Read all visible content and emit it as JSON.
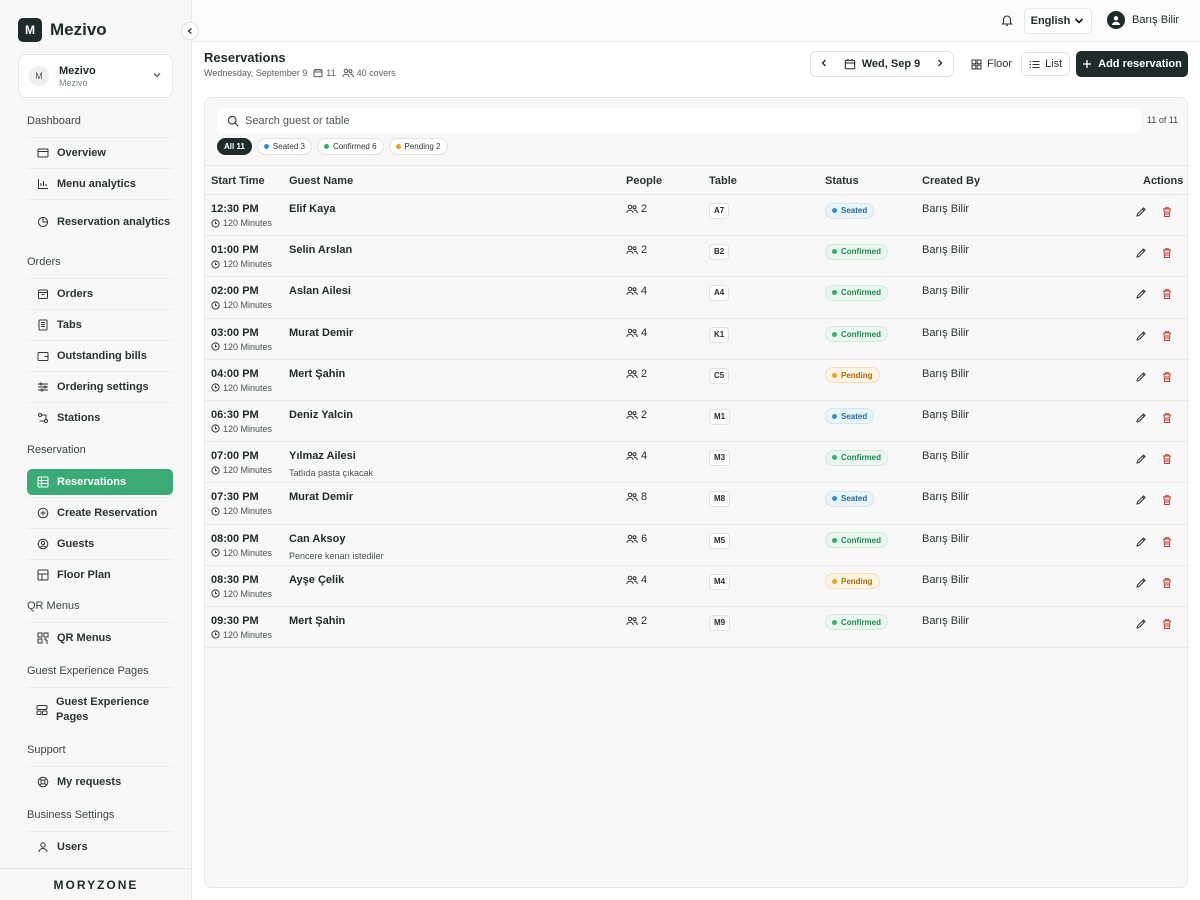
{
  "brand": {
    "logo_letter": "M",
    "name": "Mezivo"
  },
  "org": {
    "avatar": "M",
    "name": "Mezivo",
    "subtitle": "Mezivo"
  },
  "sidebar": {
    "sections": [
      {
        "title": "Dashboard",
        "items": [
          {
            "label": "Overview",
            "icon": "overview-icon"
          },
          {
            "label": "Menu analytics",
            "icon": "bar-chart-icon"
          },
          {
            "label": "Reservation analytics",
            "icon": "pie-chart-icon"
          }
        ]
      },
      {
        "title": "Orders",
        "items": [
          {
            "label": "Orders",
            "icon": "box-icon"
          },
          {
            "label": "Tabs",
            "icon": "receipt-icon"
          },
          {
            "label": "Outstanding bills",
            "icon": "wallet-icon"
          },
          {
            "label": "Ordering settings",
            "icon": "sliders-icon"
          },
          {
            "label": "Stations",
            "icon": "stations-icon"
          }
        ]
      },
      {
        "title": "Reservation",
        "items": [
          {
            "label": "Reservations",
            "icon": "grid-icon",
            "active": true
          },
          {
            "label": "Create Reservation",
            "icon": "plus-circle-icon"
          },
          {
            "label": "Guests",
            "icon": "user-circle-icon"
          },
          {
            "label": "Floor Plan",
            "icon": "floor-plan-icon"
          }
        ]
      },
      {
        "title": "QR Menus",
        "items": [
          {
            "label": "QR Menus",
            "icon": "qr-icon"
          }
        ]
      },
      {
        "title": "Guest Experience Pages",
        "items": [
          {
            "label": "Guest Experience Pages",
            "icon": "layout-icon"
          }
        ]
      },
      {
        "title": "Support",
        "items": [
          {
            "label": "My requests",
            "icon": "lifebuoy-icon"
          }
        ]
      },
      {
        "title": "Business Settings",
        "items": [
          {
            "label": "Users",
            "icon": "users-icon"
          }
        ]
      }
    ],
    "footer_logo": "MORYZONE"
  },
  "topbar": {
    "language": "English",
    "user_name": "Barış Bilir"
  },
  "header": {
    "title": "Reservations",
    "date_long": "Wednesday, September 9",
    "reservations_count": "11",
    "covers": "40 covers",
    "date_short": "Wed, Sep 9",
    "view_floor": "Floor",
    "view_list": "List",
    "add_label": "Add reservation"
  },
  "search": {
    "placeholder": "Search guest or table",
    "count": "11 of 11"
  },
  "filters": [
    {
      "label": "All 11",
      "active": true,
      "color": ""
    },
    {
      "label": "Seated 3",
      "active": false,
      "color": "#2b8fd6"
    },
    {
      "label": "Confirmed 6",
      "active": false,
      "color": "#2fb36a"
    },
    {
      "label": "Pending 2",
      "active": false,
      "color": "#f0a020"
    }
  ],
  "table": {
    "columns": [
      "Start Time",
      "Guest Name",
      "People",
      "Table",
      "Status",
      "Created By",
      "Actions"
    ],
    "rows": [
      {
        "time": "12:30 PM",
        "duration": "120 Minutes",
        "guest": "Elif Kaya",
        "note": "",
        "people": "2",
        "table": "A7",
        "status": "Seated",
        "created_by": "Barış Bilir"
      },
      {
        "time": "01:00 PM",
        "duration": "120 Minutes",
        "guest": "Selin Arslan",
        "note": "",
        "people": "2",
        "table": "B2",
        "status": "Confirmed",
        "created_by": "Barış Bilir"
      },
      {
        "time": "02:00 PM",
        "duration": "120 Minutes",
        "guest": "Aslan Ailesi",
        "note": "",
        "people": "4",
        "table": "A4",
        "status": "Confirmed",
        "created_by": "Barış Bilir"
      },
      {
        "time": "03:00 PM",
        "duration": "120 Minutes",
        "guest": "Murat Demir",
        "note": "",
        "people": "4",
        "table": "K1",
        "status": "Confirmed",
        "created_by": "Barış Bilir"
      },
      {
        "time": "04:00 PM",
        "duration": "120 Minutes",
        "guest": "Mert Şahin",
        "note": "",
        "people": "2",
        "table": "C5",
        "status": "Pending",
        "created_by": "Barış Bilir"
      },
      {
        "time": "06:30 PM",
        "duration": "120 Minutes",
        "guest": "Deniz Yalcin",
        "note": "",
        "people": "2",
        "table": "M1",
        "status": "Seated",
        "created_by": "Barış Bilir"
      },
      {
        "time": "07:00 PM",
        "duration": "120 Minutes",
        "guest": "Yılmaz Ailesi",
        "note": "Tatlıda pasta çıkacak",
        "people": "4",
        "table": "M3",
        "status": "Confirmed",
        "created_by": "Barış Bilir"
      },
      {
        "time": "07:30 PM",
        "duration": "120 Minutes",
        "guest": "Murat Demir",
        "note": "",
        "people": "8",
        "table": "M8",
        "status": "Seated",
        "created_by": "Barış Bilir"
      },
      {
        "time": "08:00 PM",
        "duration": "120 Minutes",
        "guest": "Can Aksoy",
        "note": "Pencere kenarı istediler",
        "people": "6",
        "table": "M5",
        "status": "Confirmed",
        "created_by": "Barış Bilir"
      },
      {
        "time": "08:30 PM",
        "duration": "120 Minutes",
        "guest": "Ayşe Çelik",
        "note": "",
        "people": "4",
        "table": "M4",
        "status": "Pending",
        "created_by": "Barış Bilir"
      },
      {
        "time": "09:30 PM",
        "duration": "120 Minutes",
        "guest": "Mert Şahin",
        "note": "",
        "people": "2",
        "table": "M9",
        "status": "Confirmed",
        "created_by": "Barış Bilir"
      }
    ]
  },
  "colors": {
    "accent": "#3aab74",
    "dark": "#1d2b2b",
    "seated": "#2b8fd6",
    "confirmed": "#2fb36a",
    "pending": "#f0a020",
    "delete": "#c0392b"
  }
}
